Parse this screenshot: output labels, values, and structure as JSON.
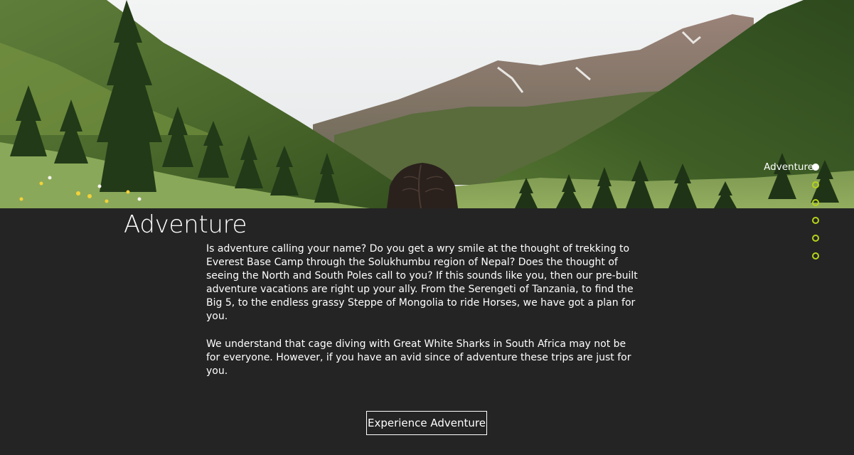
{
  "hero": {
    "image": "mountain-valley-hiker-photo"
  },
  "section": {
    "title": "Adventure",
    "paragraphs": [
      "Is adventure calling your name? Do you get a wry smile at the thought of trekking to Everest Base Camp through the Solukhumbu region of Nepal? Does the thought of seeing the North and South Poles call to you? If this sounds like you, then our pre-built adventure vacations are right up your ally. From the Serengeti of Tanzania, to find the Big 5, to the endless grassy Steppe of Mongolia to ride Horses, we have got a plan for you.",
      "We understand that cage diving with Great White Sharks in South Africa may not be for everyone. However, if you have an avid since of adventure these trips are just for you."
    ],
    "cta_label": "Experience Adventure"
  },
  "dot_nav": {
    "active_label": "Adventure",
    "active_index": 0,
    "total": 6
  },
  "colors": {
    "background": "#242424",
    "text": "#ffffff",
    "accent": "#b7d31a"
  }
}
